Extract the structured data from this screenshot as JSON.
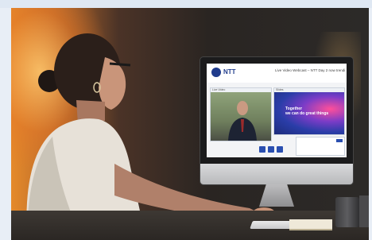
{
  "scene": {
    "description_alt": "",
    "colors": {
      "window_glow": "#e58a2b",
      "room_dark": "#2a2522",
      "brand_blue": "#1f3b8c",
      "slide_pink": "#ff4f9a",
      "slide_purple": "#7b3cc7"
    }
  },
  "screen": {
    "logo": "NTT",
    "stream_title": "Live Video Webcast – NTT Day 2 now trending",
    "presenter_panel_label": "Live Video",
    "slide_panel_label": "Slides",
    "slide_text_line1": "Together",
    "slide_text_line2": "we can do great things",
    "icons": [
      "video-icon",
      "chat-icon",
      "question-icon"
    ]
  }
}
